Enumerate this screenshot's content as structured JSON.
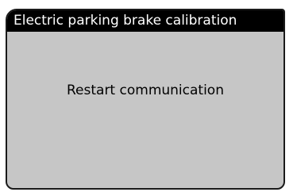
{
  "screen": {
    "title": "Electric parking brake calibration",
    "message": "Restart communication"
  },
  "colors": {
    "title_background": "#000000",
    "title_text": "#ffffff",
    "screen_background": "#c6c6c6",
    "message_text": "#000000"
  }
}
